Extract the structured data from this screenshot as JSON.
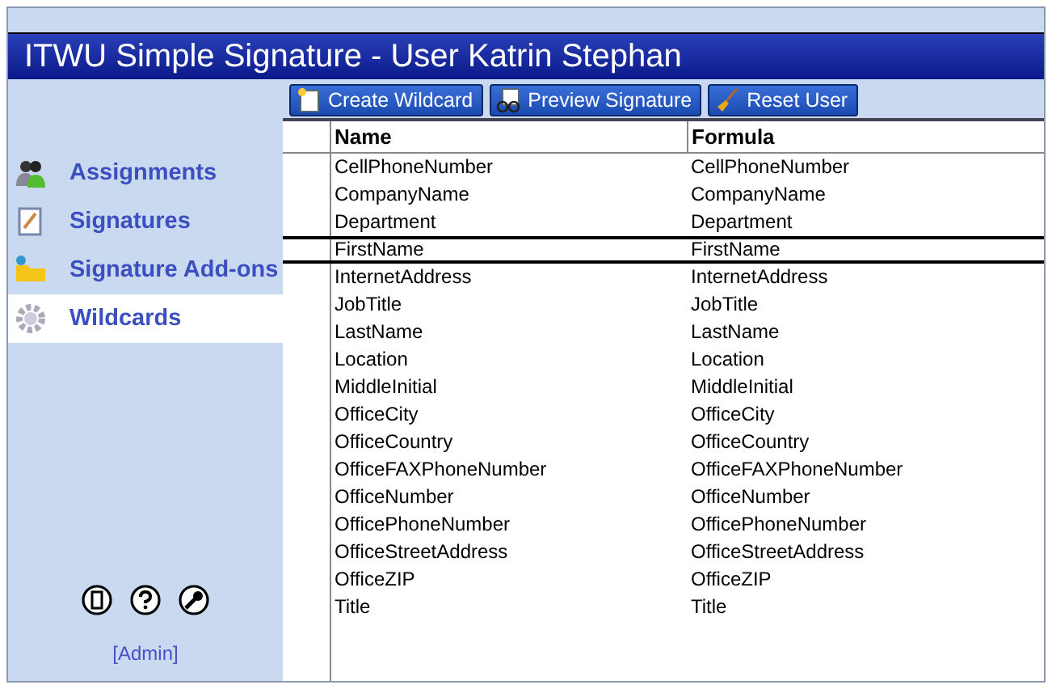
{
  "window": {
    "title": "ITWU Simple Signature - User Katrin Stephan"
  },
  "toolbar": [
    {
      "kind": "create",
      "label": "Create Wildcard"
    },
    {
      "kind": "preview",
      "label": "Preview Signature"
    },
    {
      "kind": "reset",
      "label": "Reset User"
    }
  ],
  "sidebar": {
    "items": [
      {
        "kind": "assignments",
        "label": "Assignments",
        "selected": false
      },
      {
        "kind": "signatures",
        "label": "Signatures",
        "selected": false
      },
      {
        "kind": "addons",
        "label": "Signature Add-ons",
        "selected": false
      },
      {
        "kind": "wildcards",
        "label": "Wildcards",
        "selected": true
      }
    ],
    "admin_link": "[Admin]"
  },
  "table": {
    "columns": [
      "Name",
      "Formula"
    ],
    "rows": [
      {
        "name": "CellPhoneNumber",
        "formula": "CellPhoneNumber",
        "selected": false
      },
      {
        "name": "CompanyName",
        "formula": "CompanyName",
        "selected": false
      },
      {
        "name": "Department",
        "formula": "Department",
        "selected": false
      },
      {
        "name": "FirstName",
        "formula": "FirstName",
        "selected": true
      },
      {
        "name": "InternetAddress",
        "formula": "InternetAddress",
        "selected": false
      },
      {
        "name": "JobTitle",
        "formula": "JobTitle",
        "selected": false
      },
      {
        "name": "LastName",
        "formula": "LastName",
        "selected": false
      },
      {
        "name": "Location",
        "formula": "Location",
        "selected": false
      },
      {
        "name": "MiddleInitial",
        "formula": "MiddleInitial",
        "selected": false
      },
      {
        "name": "OfficeCity",
        "formula": "OfficeCity",
        "selected": false
      },
      {
        "name": "OfficeCountry",
        "formula": "OfficeCountry",
        "selected": false
      },
      {
        "name": "OfficeFAXPhoneNumber",
        "formula": "OfficeFAXPhoneNumber",
        "selected": false
      },
      {
        "name": "OfficeNumber",
        "formula": "OfficeNumber",
        "selected": false
      },
      {
        "name": "OfficePhoneNumber",
        "formula": "OfficePhoneNumber",
        "selected": false
      },
      {
        "name": "OfficeStreetAddress",
        "formula": "OfficeStreetAddress",
        "selected": false
      },
      {
        "name": "OfficeZIP",
        "formula": "OfficeZIP",
        "selected": false
      },
      {
        "name": "Title",
        "formula": "Title",
        "selected": false
      }
    ]
  }
}
